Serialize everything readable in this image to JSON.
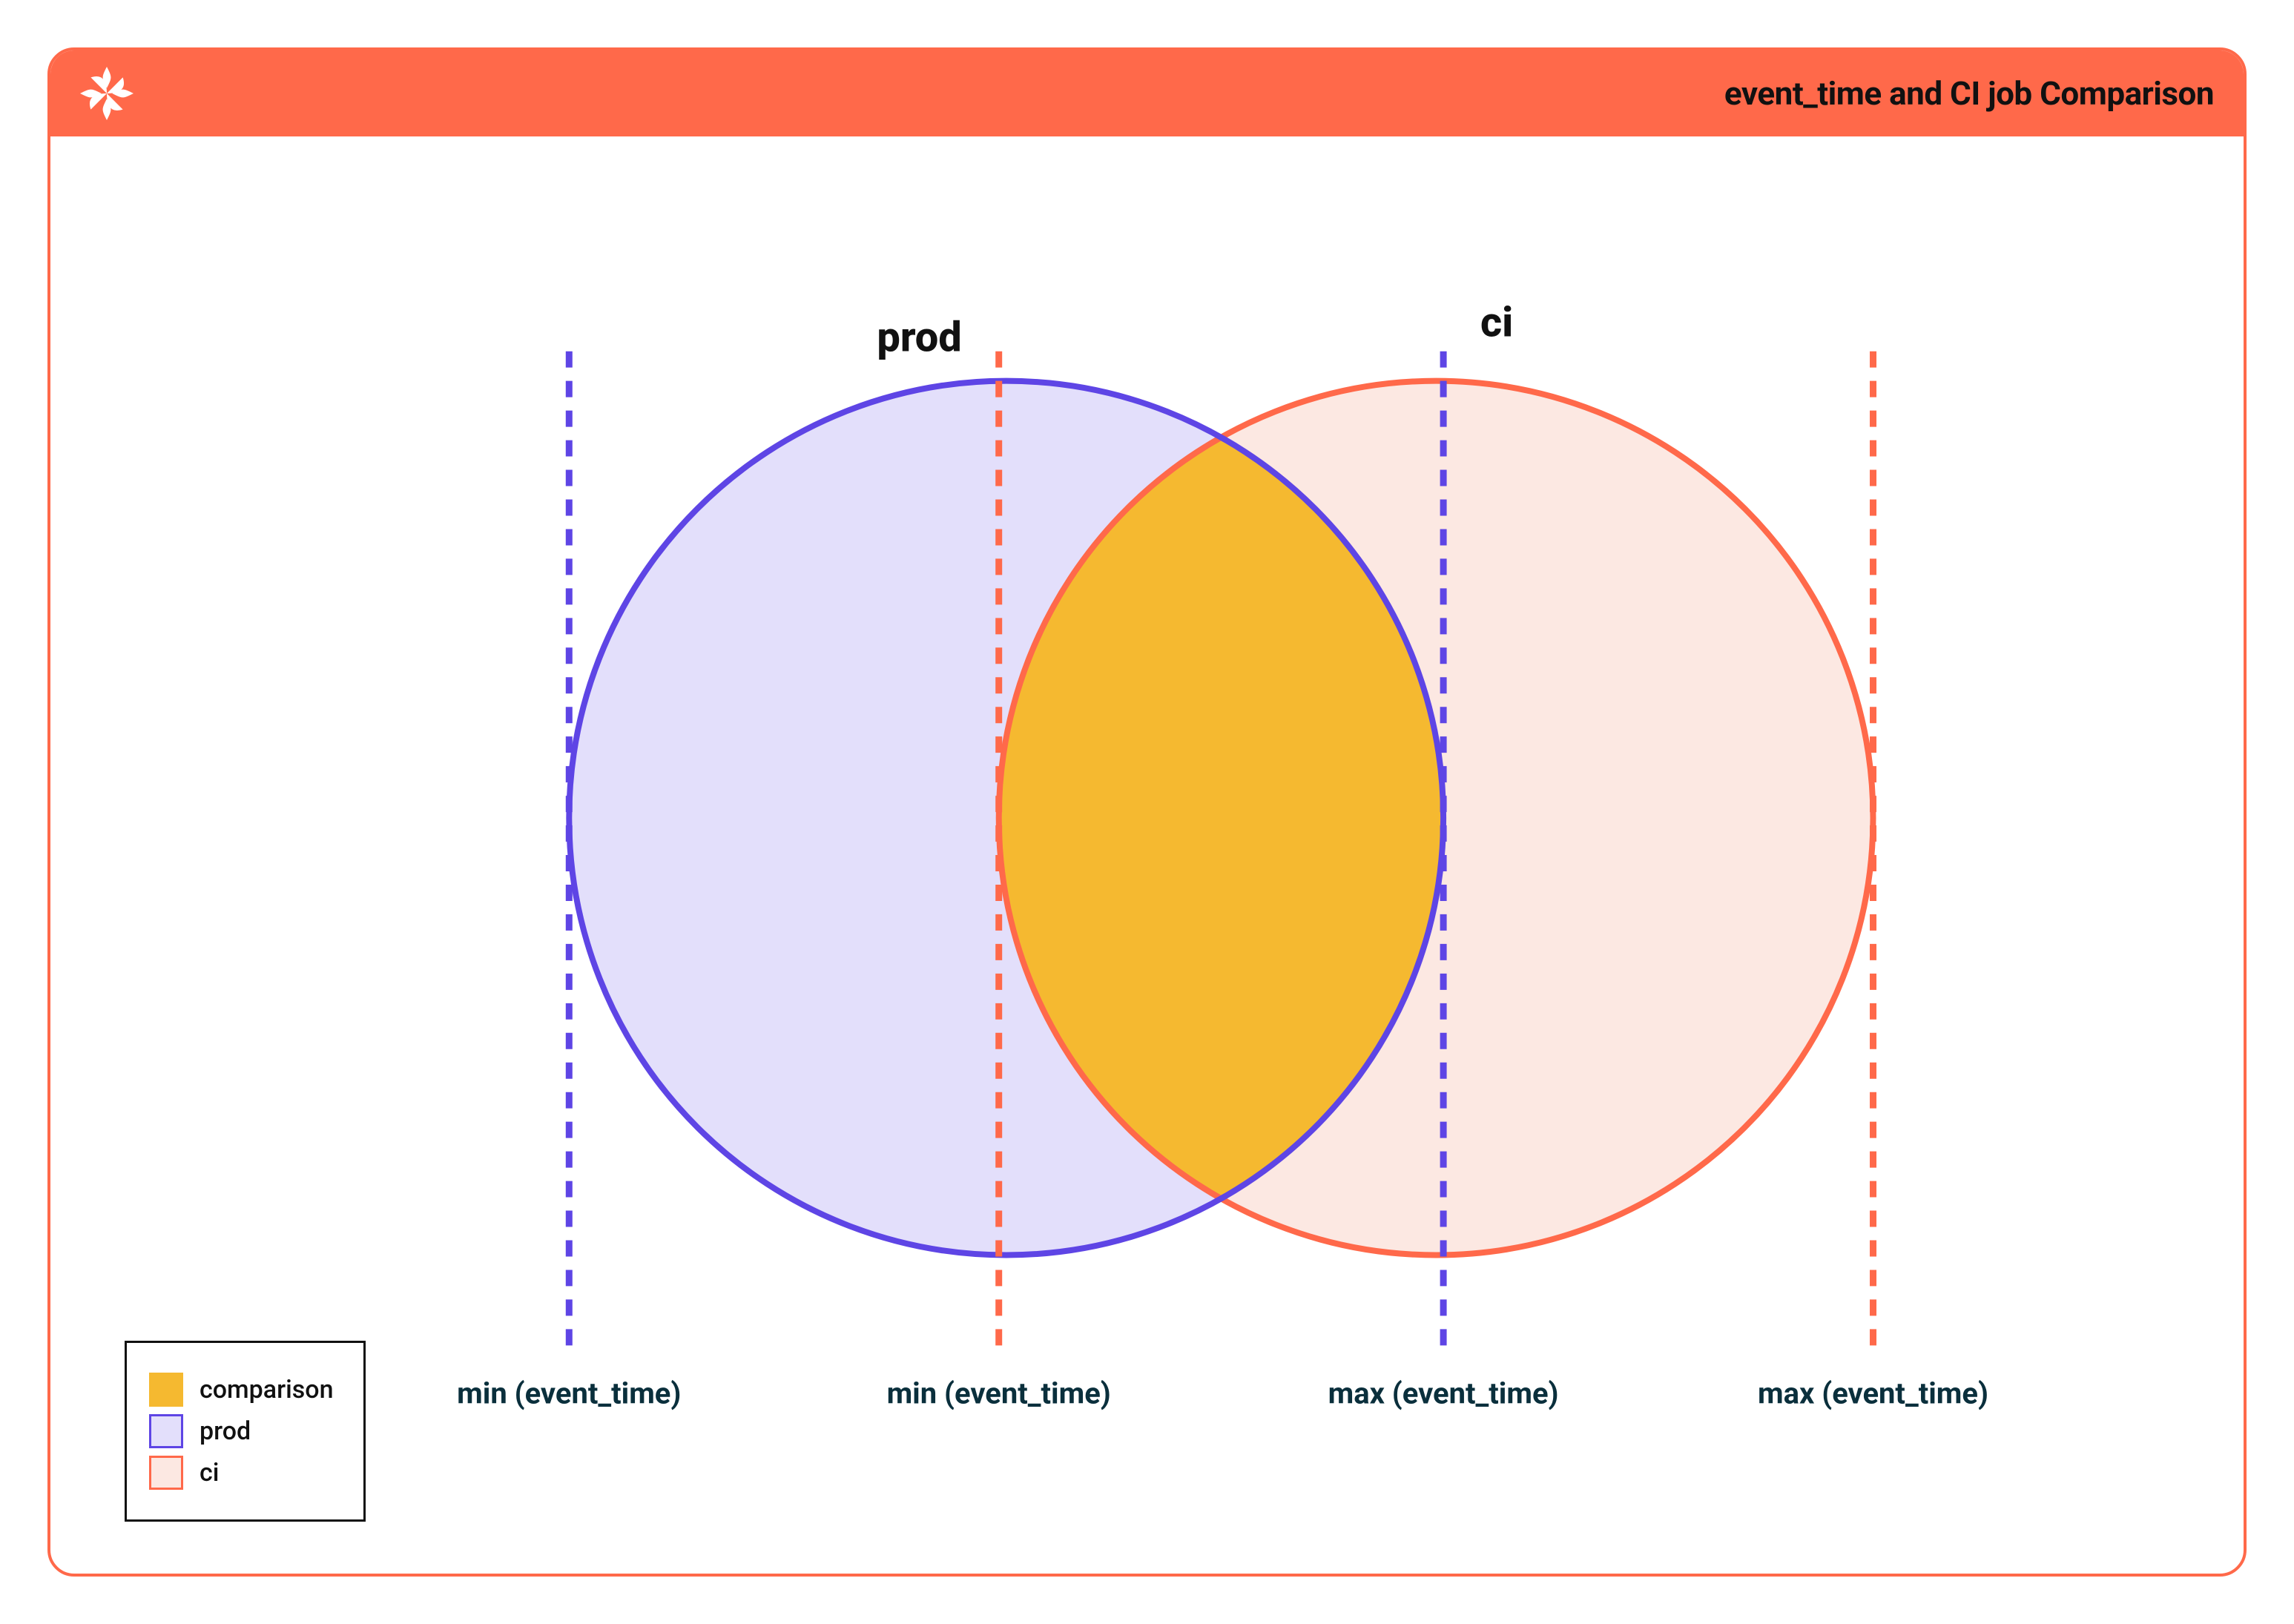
{
  "colors": {
    "accent": "#FF694A",
    "prod_stroke": "#5E45E5",
    "prod_fill": "#E3DFFB",
    "ci_stroke": "#FF694A",
    "ci_fill": "#FCE8E2",
    "comparison_fill": "#F5B930",
    "comparison_stroke": "#F5B930",
    "text_dark": "#0A2F3C"
  },
  "header": {
    "title": "event_time and CI job Comparison",
    "logo_name": "x-logo-icon"
  },
  "diagram": {
    "circles": {
      "prod": {
        "label": "prod"
      },
      "ci": {
        "label": "ci"
      }
    },
    "lines": [
      {
        "id": "prod_min",
        "label": "min (event_time)",
        "style": "prod"
      },
      {
        "id": "ci_min",
        "label": "min (event_time)",
        "style": "ci"
      },
      {
        "id": "prod_max",
        "label": "max (event_time)",
        "style": "prod"
      },
      {
        "id": "ci_max",
        "label": "max (event_time)",
        "style": "ci"
      }
    ]
  },
  "legend": {
    "items": [
      {
        "name": "comparison",
        "fill": "#F5B930",
        "stroke": "#F5B930"
      },
      {
        "name": "prod",
        "fill": "#E3DFFB",
        "stroke": "#5E45E5"
      },
      {
        "name": "ci",
        "fill": "#FCE8E2",
        "stroke": "#FF694A"
      }
    ]
  }
}
